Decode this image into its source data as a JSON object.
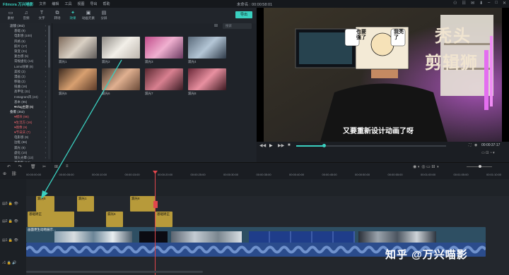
{
  "app": {
    "logo": "Filmora 万兴喵影",
    "window_title": "未命名 : 00:00:58:01"
  },
  "menu": [
    "文件",
    "编辑",
    "工具",
    "视图",
    "导出",
    "帮助"
  ],
  "toolbar": {
    "items": [
      {
        "label": "素材",
        "icon": "folder-icon"
      },
      {
        "label": "音频",
        "icon": "music-note-icon"
      },
      {
        "label": "文字",
        "icon": "text-icon"
      },
      {
        "label": "转场",
        "icon": "transition-icon"
      },
      {
        "label": "效果",
        "icon": "effects-icon"
      },
      {
        "label": "动画元素",
        "icon": "elements-icon"
      },
      {
        "label": "分屏",
        "icon": "split-screen-icon"
      }
    ],
    "export_label": "导出"
  },
  "sidebar": {
    "items": [
      {
        "label": "滤镜 (362)",
        "type": "head"
      },
      {
        "label": "基础 (9)"
      },
      {
        "label": "电影感 (100)"
      },
      {
        "label": "风格 (6)"
      },
      {
        "label": "胶片 (17)"
      },
      {
        "label": "渐变 (21)"
      },
      {
        "label": "复古感 (5)"
      },
      {
        "label": "常规虚化 (14)"
      },
      {
        "label": "Lomo效果 (8)"
      },
      {
        "label": "美妆 (2)"
      },
      {
        "label": "漫画 (2)"
      },
      {
        "label": "移轴 (2)"
      },
      {
        "label": "扭曲 (16)"
      },
      {
        "label": "高甲化 (11)"
      },
      {
        "label": "Instagram风 (24)"
      },
      {
        "label": "基本 (85)"
      },
      {
        "label": "♥Vlog主题 (6)",
        "type": "hl"
      },
      {
        "label": "叠覆 (352)",
        "type": "head"
      },
      {
        "label": "♥模块 (96)",
        "type": "red"
      },
      {
        "label": "♥生活方 (16)",
        "type": "red"
      },
      {
        "label": "♥图像 (9)",
        "type": "red"
      },
      {
        "label": "♥节日庆 (7)",
        "type": "red"
      },
      {
        "label": "电影感 (9)"
      },
      {
        "label": "边框 (88)"
      },
      {
        "label": "漏光 (8)"
      },
      {
        "label": "虚化 (10)"
      },
      {
        "label": "镜头光晕 (12)"
      },
      {
        "label": "老电影 (12)"
      }
    ]
  },
  "grid": {
    "search_placeholder": "搜索",
    "items": [
      {
        "label": "漏光1"
      },
      {
        "label": "漏光2"
      },
      {
        "label": "漏光3"
      },
      {
        "label": "漏光4"
      },
      {
        "label": "漏光5"
      },
      {
        "label": "漏光6"
      },
      {
        "label": "漏光7"
      },
      {
        "label": "漏光8"
      }
    ]
  },
  "preview": {
    "bubble_left": "也要强了",
    "bubble_right": "我秃了",
    "title_line1": "秃头",
    "title_line2": "剪辑狮",
    "subtitle": "又要重新设计动画了呀",
    "timecode": "00:00:37:17"
  },
  "timeline": {
    "ruler_labels": [
      "00:00:00:00",
      "00:00:05:00",
      "00:00:10:00",
      "00:00:15:00",
      "00:00:20:00",
      "00:00:25:00",
      "00:00:30:00",
      "00:00:35:00",
      "00:00:40:00",
      "00:00:45:00",
      "00:00:50:00",
      "00:00:55:00",
      "00:01:00:00",
      "00:01:05:00",
      "00:01:10:00"
    ],
    "track_labels": [
      "3",
      "2",
      "1",
      "1"
    ],
    "clips_overlay": [
      {
        "label": "漏光5"
      },
      {
        "label": "漏光1"
      },
      {
        "label": "漏光8"
      }
    ],
    "clips_effects": [
      {
        "label": "基础矫正"
      },
      {
        "label": "漏光6"
      },
      {
        "label": "基础矫正"
      }
    ],
    "main_clip_label": "画面更生动地展示…",
    "audio_label": "1"
  },
  "watermark": "知乎 @万兴喵影",
  "colors": {
    "accent": "#3ad0c0",
    "clip_gold": "#b79a3a",
    "playhead": "#e0464c"
  }
}
